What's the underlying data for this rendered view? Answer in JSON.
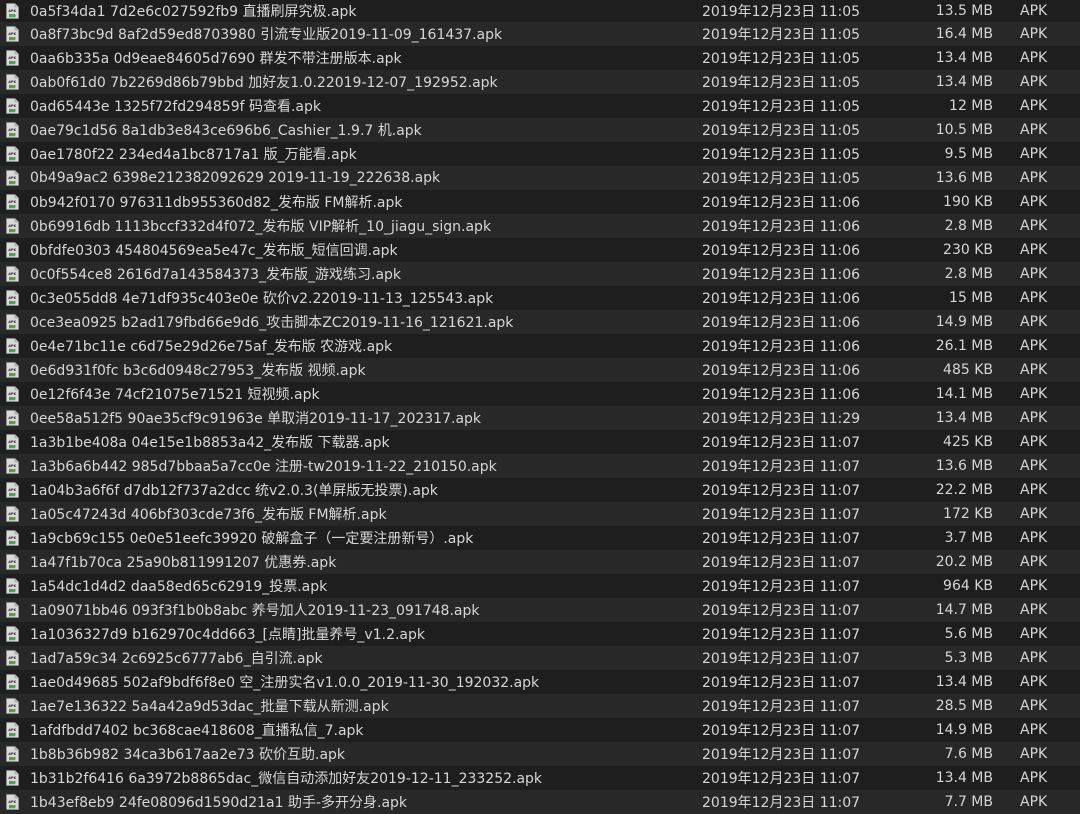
{
  "icon": "apk-file-icon",
  "icon_label": "APK",
  "colors": {
    "background": "#1e1e1e",
    "row_alt": "#282828",
    "text": "#d6d6d6",
    "icon_body": "#d9d9d9",
    "icon_badge": "#4aa84a"
  },
  "files": [
    {
      "name": "0a5f34da1 7d2e6c027592fb9 直播刷屏究极.apk",
      "date": "2019年12月23日 11:05",
      "size": "13.5 MB",
      "kind": "APK"
    },
    {
      "name": "0a8f73bc9d 8af2d59ed8703980 引流专业版2019-11-09_161437.apk",
      "date": "2019年12月23日 11:05",
      "size": "16.4 MB",
      "kind": "APK"
    },
    {
      "name": "0aa6b335a 0d9eae84605d7690 群发不带注册版本.apk",
      "date": "2019年12月23日 11:05",
      "size": "13.4 MB",
      "kind": "APK"
    },
    {
      "name": "0ab0f61d0 7b2269d86b79bbd 加好友1.0.22019-12-07_192952.apk",
      "date": "2019年12月23日 11:05",
      "size": "13.4 MB",
      "kind": "APK"
    },
    {
      "name": "0ad65443e 1325f72fd294859f 码查看.apk",
      "date": "2019年12月23日 11:05",
      "size": "12 MB",
      "kind": "APK"
    },
    {
      "name": "0ae79c1d56 8a1db3e843ce696b6_Cashier_1.9.7 机.apk",
      "date": "2019年12月23日 11:05",
      "size": "10.5 MB",
      "kind": "APK"
    },
    {
      "name": "0ae1780f22 234ed4a1bc8717a1 版_万能看.apk",
      "date": "2019年12月23日 11:05",
      "size": "9.5 MB",
      "kind": "APK"
    },
    {
      "name": "0b49a9ac2 6398e212382092629 2019-11-19_222638.apk",
      "date": "2019年12月23日 11:05",
      "size": "13.6 MB",
      "kind": "APK"
    },
    {
      "name": "0b942f0170 976311db955360d82_发布版 FM解析.apk",
      "date": "2019年12月23日 11:06",
      "size": "190 KB",
      "kind": "APK"
    },
    {
      "name": "0b69916db 1113bccf332d4f072_发布版 VIP解析_10_jiagu_sign.apk",
      "date": "2019年12月23日 11:06",
      "size": "2.8 MB",
      "kind": "APK"
    },
    {
      "name": "0bfdfe0303 454804569ea5e47c_发布版_短信回调.apk",
      "date": "2019年12月23日 11:06",
      "size": "230 KB",
      "kind": "APK"
    },
    {
      "name": "0c0f554ce8 2616d7a143584373_发布版_游戏练习.apk",
      "date": "2019年12月23日 11:06",
      "size": "2.8 MB",
      "kind": "APK"
    },
    {
      "name": "0c3e055dd8 4e71df935c403e0e 砍价v2.22019-11-13_125543.apk",
      "date": "2019年12月23日 11:06",
      "size": "15 MB",
      "kind": "APK"
    },
    {
      "name": "0ce3ea0925 b2ad179fbd66e9d6_攻击脚本ZC2019-11-16_121621.apk",
      "date": "2019年12月23日 11:06",
      "size": "14.9 MB",
      "kind": "APK"
    },
    {
      "name": "0e4e71bc11e c6d75e29d26e75af_发布版 农游戏.apk",
      "date": "2019年12月23日 11:06",
      "size": "26.1 MB",
      "kind": "APK"
    },
    {
      "name": "0e6d931f0fc b3c6d0948c27953_发布版 视频.apk",
      "date": "2019年12月23日 11:06",
      "size": "485 KB",
      "kind": "APK"
    },
    {
      "name": "0e12f6f43e 74cf21075e71521 短视频.apk",
      "date": "2019年12月23日 11:06",
      "size": "14.1 MB",
      "kind": "APK"
    },
    {
      "name": "0ee58a512f5 90ae35cf9c91963e 单取消2019-11-17_202317.apk",
      "date": "2019年12月23日 11:29",
      "size": "13.4 MB",
      "kind": "APK"
    },
    {
      "name": "1a3b1be408a 04e15e1b8853a42_发布版 下载器.apk",
      "date": "2019年12月23日 11:07",
      "size": "425 KB",
      "kind": "APK"
    },
    {
      "name": "1a3b6a6b442 985d7bbaa5a7cc0e 注册-tw2019-11-22_210150.apk",
      "date": "2019年12月23日 11:07",
      "size": "13.6 MB",
      "kind": "APK"
    },
    {
      "name": "1a04b3a6f6f d7db12f737a2dcc 统v2.0.3(单屏版无投票).apk",
      "date": "2019年12月23日 11:07",
      "size": "22.2 MB",
      "kind": "APK"
    },
    {
      "name": "1a05c47243d 406bf303cde73f6_发布版 FM解析.apk",
      "date": "2019年12月23日 11:07",
      "size": "172 KB",
      "kind": "APK"
    },
    {
      "name": "1a9cb69c155 0e0e51eefc39920 破解盒子（一定要注册新号）.apk",
      "date": "2019年12月23日 11:07",
      "size": "3.7 MB",
      "kind": "APK"
    },
    {
      "name": "1a47f1b70ca 25a90b811991207 优惠券.apk",
      "date": "2019年12月23日 11:07",
      "size": "20.2 MB",
      "kind": "APK"
    },
    {
      "name": "1a54dc1d4d2 daa58ed65c62919_投票.apk",
      "date": "2019年12月23日 11:07",
      "size": "964 KB",
      "kind": "APK"
    },
    {
      "name": "1a09071bb46 093f3f1b0b8abc 养号加人2019-11-23_091748.apk",
      "date": "2019年12月23日 11:07",
      "size": "14.7 MB",
      "kind": "APK"
    },
    {
      "name": "1a1036327d9 b162970c4dd663_[点睛]批量养号_v1.2.apk",
      "date": "2019年12月23日 11:07",
      "size": "5.6 MB",
      "kind": "APK"
    },
    {
      "name": "1ad7a59c34 2c6925c6777ab6_自引流.apk",
      "date": "2019年12月23日 11:07",
      "size": "5.3 MB",
      "kind": "APK"
    },
    {
      "name": "1ae0d49685 502af9bdf6f8e0 空_注册实名v1.0.0_2019-11-30_192032.apk",
      "date": "2019年12月23日 11:07",
      "size": "13.4 MB",
      "kind": "APK"
    },
    {
      "name": "1ae7e136322 5a4a42a9d53dac_批量下载从新测.apk",
      "date": "2019年12月23日 11:07",
      "size": "28.5 MB",
      "kind": "APK"
    },
    {
      "name": "1afdfbdd7402 bc368cae418608_直播私信_7.apk",
      "date": "2019年12月23日 11:07",
      "size": "14.9 MB",
      "kind": "APK"
    },
    {
      "name": "1b8b36b982 34ca3b617aa2e73 砍价互助.apk",
      "date": "2019年12月23日 11:07",
      "size": "7.6 MB",
      "kind": "APK"
    },
    {
      "name": "1b31b2f6416 6a3972b8865dac_微信自动添加好友2019-12-11_233252.apk",
      "date": "2019年12月23日 11:07",
      "size": "13.4 MB",
      "kind": "APK"
    },
    {
      "name": "1b43ef8eb9 24fe08096d1590d21a1 助手-多开分身.apk",
      "date": "2019年12月23日 11:07",
      "size": "7.7 MB",
      "kind": "APK"
    }
  ]
}
